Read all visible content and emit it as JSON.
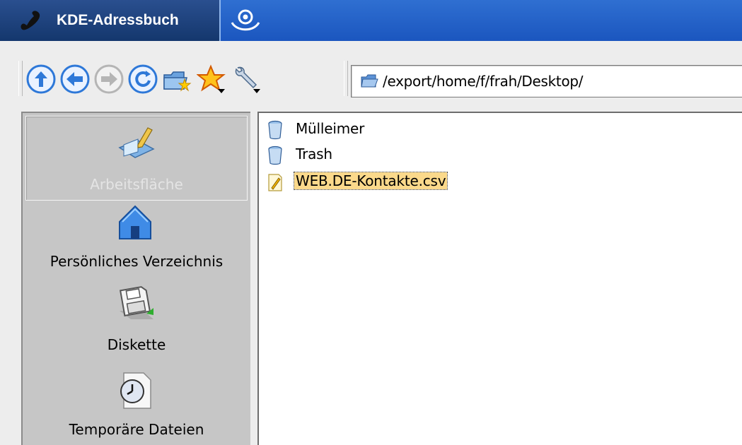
{
  "window": {
    "title": "KDE-Adressbuch",
    "title_icon": "phone-icon",
    "system_icon": "kde-menu-icon"
  },
  "toolbar": {
    "buttons": [
      {
        "name": "up-button",
        "icon": "arrow-up-icon"
      },
      {
        "name": "back-button",
        "icon": "arrow-left-icon"
      },
      {
        "name": "forward-button",
        "icon": "arrow-right-icon",
        "disabled": true
      },
      {
        "name": "reload-button",
        "icon": "reload-icon"
      },
      {
        "name": "new-folder-button",
        "icon": "folder-new-icon"
      },
      {
        "name": "bookmarks-button",
        "icon": "star-icon"
      },
      {
        "name": "settings-button",
        "icon": "wrench-icon"
      }
    ]
  },
  "location": {
    "path": "/export/home/f/frah/Desktop/",
    "icon": "folder-icon"
  },
  "sidebar": {
    "items": [
      {
        "label": "Arbeitsfläche",
        "icon": "desktop-icon",
        "selected": true
      },
      {
        "label": "Persönliches Verzeichnis",
        "icon": "home-icon",
        "selected": false
      },
      {
        "label": "Diskette",
        "icon": "floppy-icon",
        "selected": false
      },
      {
        "label": "Temporäre Dateien",
        "icon": "clock-icon",
        "selected": false
      }
    ]
  },
  "files": [
    {
      "name": "Mülleimer",
      "icon": "trash-icon",
      "selected": false
    },
    {
      "name": "Trash",
      "icon": "trash-icon",
      "selected": false
    },
    {
      "name": "WEB.DE-Kontakte.csv",
      "icon": "text-file-icon",
      "selected": true
    }
  ],
  "colors": {
    "titlebar": "#1b56bf",
    "selection": "#fbd98b",
    "sidebar_bg": "#c6c6c6"
  }
}
